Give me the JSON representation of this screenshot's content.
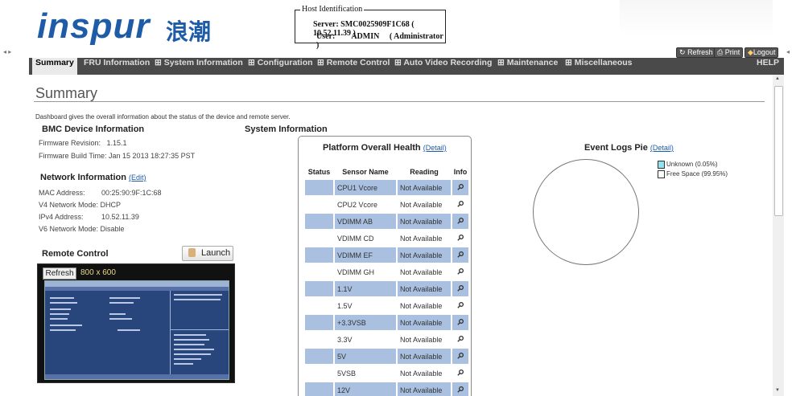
{
  "header": {
    "logo": "inspur",
    "logo_cn": "浪潮",
    "host_legend": "Host Identification",
    "server_label": "Server:",
    "server_value": "SMC0025909F1C68 (  10.52.11.39  )",
    "user_label": "User:",
    "user_value": "ADMIN",
    "user_role": "( Administrator )",
    "refresh_label": "Refresh",
    "print_label": "Print",
    "logout_label": "Logout"
  },
  "nav": {
    "items": [
      "Summary",
      "FRU Information",
      "⊞ System Information",
      "⊞ Configuration",
      "⊞ Remote Control",
      "⊞ Auto Video Recording",
      "⊞ Maintenance",
      "⊞ Miscellaneous"
    ],
    "help": "HELP"
  },
  "page": {
    "title": "Summary",
    "intro": "Dashboard gives the overall information about the status of the device and remote server."
  },
  "bmc": {
    "heading": "BMC Device Information",
    "firmware_revision_label": "Firmware Revision:",
    "firmware_revision": "1.15.1",
    "firmware_build_label": "Firmware Build Time:",
    "firmware_build": "Jan 15 2013 18:27:35 PST"
  },
  "network": {
    "heading": "Network Information",
    "edit_link": "(Edit)",
    "mac_label": "MAC Address:",
    "mac": "00:25:90:9F:1C:68",
    "v4mode_label": "V4 Network Mode:",
    "v4mode": "DHCP",
    "ipv4_label": "IPv4 Address:",
    "ipv4": "10.52.11.39",
    "v6mode_label": "V6 Network Mode:",
    "v6mode": "Disable"
  },
  "remote": {
    "heading": "Remote Control",
    "launch_label": "Launch",
    "refresh_label": "Refresh",
    "resolution": "800 x 600"
  },
  "system": {
    "heading": "System Information",
    "health_title": "Platform Overall Health",
    "detail_link": "(Detail)",
    "columns": [
      "Status",
      "Sensor Name",
      "Reading",
      "Info"
    ],
    "sensors": [
      {
        "name": "CPU1 Vcore",
        "reading": "Not Available"
      },
      {
        "name": "CPU2 Vcore",
        "reading": "Not Available"
      },
      {
        "name": "VDIMM AB",
        "reading": "Not Available"
      },
      {
        "name": "VDIMM CD",
        "reading": "Not Available"
      },
      {
        "name": "VDIMM EF",
        "reading": "Not Available"
      },
      {
        "name": "VDIMM GH",
        "reading": "Not Available"
      },
      {
        "name": "1.1V",
        "reading": "Not Available"
      },
      {
        "name": "1.5V",
        "reading": "Not Available"
      },
      {
        "name": "+3.3VSB",
        "reading": "Not Available"
      },
      {
        "name": "3.3V",
        "reading": "Not Available"
      },
      {
        "name": "5V",
        "reading": "Not Available"
      },
      {
        "name": "5VSB",
        "reading": "Not Available"
      },
      {
        "name": "12V",
        "reading": "Not Available"
      }
    ]
  },
  "events": {
    "heading": "Event Logs Pie",
    "detail_link": "(Detail)",
    "legend": [
      {
        "label": "Unknown (0.05%)",
        "color": "#8fe3f0"
      },
      {
        "label": "Free Space (99.95%)",
        "color": "#ffffff"
      }
    ]
  },
  "colors": {
    "nav_bg": "#4a4a4a",
    "row_highlight": "#a9c0e1",
    "brand": "#1f5ca8"
  }
}
